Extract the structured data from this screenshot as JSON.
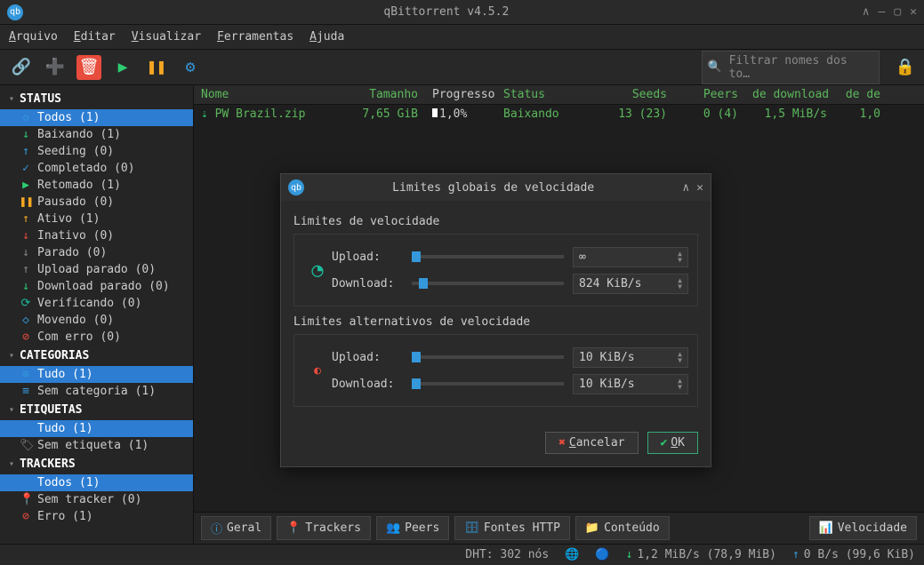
{
  "window": {
    "title": "qBittorrent v4.5.2"
  },
  "menu": {
    "file": "Arquivo",
    "edit": "Editar",
    "view": "Visualizar",
    "tools": "Ferramentas",
    "help": "Ajuda"
  },
  "toolbar": {
    "search_placeholder": "Filtrar nomes dos to…"
  },
  "sidebar": {
    "status": {
      "header": "STATUS",
      "items": [
        {
          "label": "Todos (1)",
          "icon": "◇",
          "color": "ico-blue",
          "selected": true
        },
        {
          "label": "Baixando (1)",
          "icon": "↓",
          "color": "ico-green"
        },
        {
          "label": "Seeding (0)",
          "icon": "↑",
          "color": "ico-blue"
        },
        {
          "label": "Completado (0)",
          "icon": "✓",
          "color": "ico-blue"
        },
        {
          "label": "Retomado (1)",
          "icon": "▶",
          "color": "ico-green"
        },
        {
          "label": "Pausado (0)",
          "icon": "❚❚",
          "color": "ico-orange"
        },
        {
          "label": "Ativo (1)",
          "icon": "↑",
          "color": "ico-orange"
        },
        {
          "label": "Inativo (0)",
          "icon": "↓",
          "color": "ico-red"
        },
        {
          "label": "Parado (0)",
          "icon": "↓",
          "color": "ico-gray"
        },
        {
          "label": "Upload parado (0)",
          "icon": "↑",
          "color": "ico-gray"
        },
        {
          "label": "Download parado (0)",
          "icon": "↓",
          "color": "ico-green"
        },
        {
          "label": "Verificando (0)",
          "icon": "⟳",
          "color": "ico-teal"
        },
        {
          "label": "Movendo (0)",
          "icon": "◇",
          "color": "ico-blue"
        },
        {
          "label": "Com erro (0)",
          "icon": "⊘",
          "color": "ico-red"
        }
      ]
    },
    "categories": {
      "header": "CATEGORIAS",
      "items": [
        {
          "label": "Tudo (1)",
          "icon": "≡",
          "color": "ico-blue",
          "selected": true
        },
        {
          "label": "Sem categoria (1)",
          "icon": "≡",
          "color": "ico-blue"
        }
      ]
    },
    "tags": {
      "header": "ETIQUETAS",
      "items": [
        {
          "label": "Tudo (1)",
          "icon": "",
          "color": "",
          "selected": true
        },
        {
          "label": "Sem etiqueta (1)",
          "icon": "🏷",
          "color": "ico-gray"
        }
      ]
    },
    "trackers": {
      "header": "TRACKERS",
      "items": [
        {
          "label": "Todos (1)",
          "icon": "",
          "color": "",
          "selected": true
        },
        {
          "label": "Sem tracker (0)",
          "icon": "📍",
          "color": "ico-gray"
        },
        {
          "label": "Erro (1)",
          "icon": "⊘",
          "color": "ico-red"
        }
      ]
    }
  },
  "table": {
    "headers": {
      "name": "Nome",
      "size": "Tamanho",
      "progress": "Progresso",
      "status": "Status",
      "seeds": "Seeds",
      "peers": "Peers",
      "dl": "de download",
      "rest": "de de"
    },
    "rows": [
      {
        "name": "PW Brazil.zip",
        "size": "7,65 GiB",
        "progress": "1,0%",
        "status": "Baixando",
        "seeds": "13 (23)",
        "peers": "0 (4)",
        "dl": "1,5 MiB/s",
        "rest": "1,0"
      }
    ]
  },
  "tabs": {
    "general": "Geral",
    "trackers": "Trackers",
    "peers": "Peers",
    "http": "Fontes HTTP",
    "content": "Conteúdo",
    "speed": "Velocidade"
  },
  "status": {
    "dht": "DHT: 302 nós",
    "down": "1,2 MiB/s (78,9 MiB)",
    "up": "0 B/s (99,6 KiB)"
  },
  "dialog": {
    "title": "Limites globais de velocidade",
    "section1": "Limites de velocidade",
    "section2": "Limites alternativos de velocidade",
    "upload_label": "Upload:",
    "download_label": "Download:",
    "upload_value": "∞",
    "download_value": "824 KiB/s",
    "alt_upload_value": "10 KiB/s",
    "alt_download_value": "10 KiB/s",
    "cancel": "Cancelar",
    "ok": "OK"
  }
}
